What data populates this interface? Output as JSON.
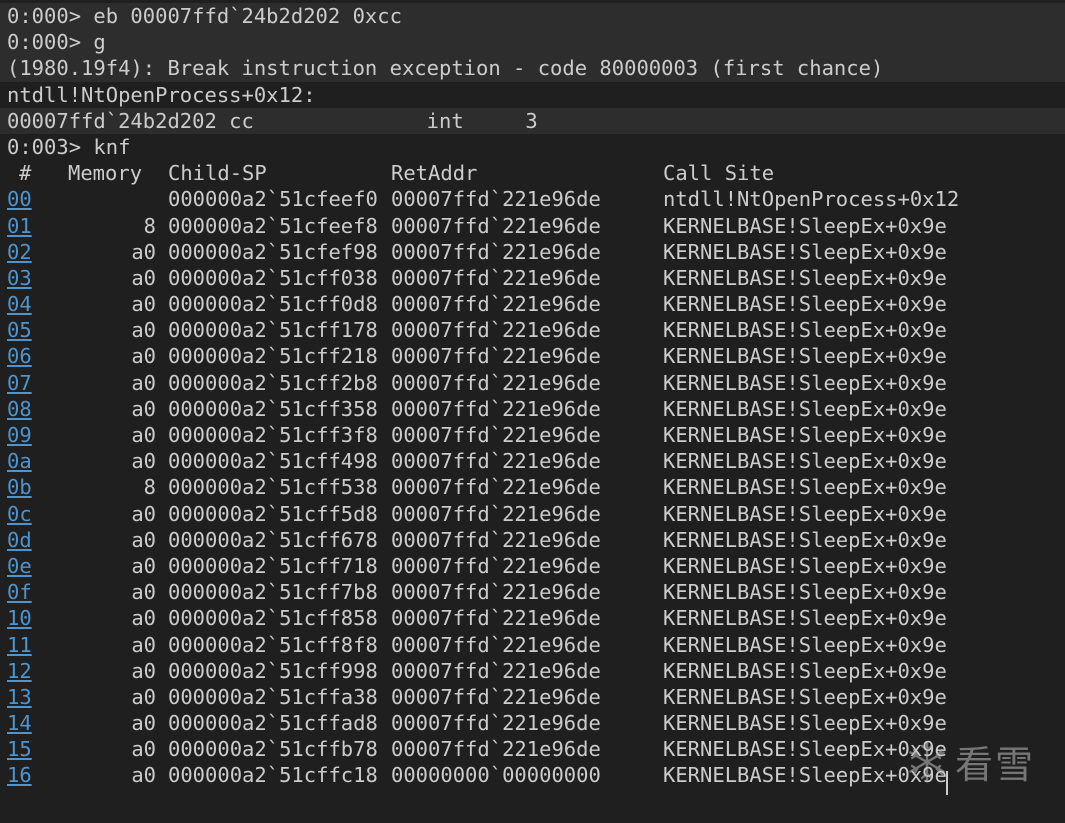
{
  "console": {
    "lines": [
      {
        "text": "0:000> eb 00007ffd`24b2d202 0xcc",
        "highlight": true
      },
      {
        "text": "0:000> g",
        "highlight": true
      },
      {
        "text": "(1980.19f4): Break instruction exception - code 80000003 (first chance)",
        "highlight": true
      },
      {
        "text": "ntdll!NtOpenProcess+0x12:",
        "highlight": false
      },
      {
        "text": "00007ffd`24b2d202 cc              int     3",
        "highlight": true
      },
      {
        "text": "0:003> knf",
        "highlight": false
      }
    ]
  },
  "stack_table": {
    "headers": {
      "num": "#",
      "memory": "Memory",
      "child_sp": "Child-SP",
      "ret_addr": "RetAddr",
      "call_site": "Call Site"
    },
    "rows": [
      {
        "num": "00",
        "memory": "",
        "child_sp": "000000a2`51cfeef0",
        "ret_addr": "00007ffd`221e96de",
        "call_site": "ntdll!NtOpenProcess+0x12"
      },
      {
        "num": "01",
        "memory": "8",
        "child_sp": "000000a2`51cfeef8",
        "ret_addr": "00007ffd`221e96de",
        "call_site": "KERNELBASE!SleepEx+0x9e"
      },
      {
        "num": "02",
        "memory": "a0",
        "child_sp": "000000a2`51cfef98",
        "ret_addr": "00007ffd`221e96de",
        "call_site": "KERNELBASE!SleepEx+0x9e"
      },
      {
        "num": "03",
        "memory": "a0",
        "child_sp": "000000a2`51cff038",
        "ret_addr": "00007ffd`221e96de",
        "call_site": "KERNELBASE!SleepEx+0x9e"
      },
      {
        "num": "04",
        "memory": "a0",
        "child_sp": "000000a2`51cff0d8",
        "ret_addr": "00007ffd`221e96de",
        "call_site": "KERNELBASE!SleepEx+0x9e"
      },
      {
        "num": "05",
        "memory": "a0",
        "child_sp": "000000a2`51cff178",
        "ret_addr": "00007ffd`221e96de",
        "call_site": "KERNELBASE!SleepEx+0x9e"
      },
      {
        "num": "06",
        "memory": "a0",
        "child_sp": "000000a2`51cff218",
        "ret_addr": "00007ffd`221e96de",
        "call_site": "KERNELBASE!SleepEx+0x9e"
      },
      {
        "num": "07",
        "memory": "a0",
        "child_sp": "000000a2`51cff2b8",
        "ret_addr": "00007ffd`221e96de",
        "call_site": "KERNELBASE!SleepEx+0x9e"
      },
      {
        "num": "08",
        "memory": "a0",
        "child_sp": "000000a2`51cff358",
        "ret_addr": "00007ffd`221e96de",
        "call_site": "KERNELBASE!SleepEx+0x9e"
      },
      {
        "num": "09",
        "memory": "a0",
        "child_sp": "000000a2`51cff3f8",
        "ret_addr": "00007ffd`221e96de",
        "call_site": "KERNELBASE!SleepEx+0x9e"
      },
      {
        "num": "0a",
        "memory": "a0",
        "child_sp": "000000a2`51cff498",
        "ret_addr": "00007ffd`221e96de",
        "call_site": "KERNELBASE!SleepEx+0x9e"
      },
      {
        "num": "0b",
        "memory": "8",
        "child_sp": "000000a2`51cff538",
        "ret_addr": "00007ffd`221e96de",
        "call_site": "KERNELBASE!SleepEx+0x9e"
      },
      {
        "num": "0c",
        "memory": "a0",
        "child_sp": "000000a2`51cff5d8",
        "ret_addr": "00007ffd`221e96de",
        "call_site": "KERNELBASE!SleepEx+0x9e"
      },
      {
        "num": "0d",
        "memory": "a0",
        "child_sp": "000000a2`51cff678",
        "ret_addr": "00007ffd`221e96de",
        "call_site": "KERNELBASE!SleepEx+0x9e"
      },
      {
        "num": "0e",
        "memory": "a0",
        "child_sp": "000000a2`51cff718",
        "ret_addr": "00007ffd`221e96de",
        "call_site": "KERNELBASE!SleepEx+0x9e"
      },
      {
        "num": "0f",
        "memory": "a0",
        "child_sp": "000000a2`51cff7b8",
        "ret_addr": "00007ffd`221e96de",
        "call_site": "KERNELBASE!SleepEx+0x9e"
      },
      {
        "num": "10",
        "memory": "a0",
        "child_sp": "000000a2`51cff858",
        "ret_addr": "00007ffd`221e96de",
        "call_site": "KERNELBASE!SleepEx+0x9e"
      },
      {
        "num": "11",
        "memory": "a0",
        "child_sp": "000000a2`51cff8f8",
        "ret_addr": "00007ffd`221e96de",
        "call_site": "KERNELBASE!SleepEx+0x9e"
      },
      {
        "num": "12",
        "memory": "a0",
        "child_sp": "000000a2`51cff998",
        "ret_addr": "00007ffd`221e96de",
        "call_site": "KERNELBASE!SleepEx+0x9e"
      },
      {
        "num": "13",
        "memory": "a0",
        "child_sp": "000000a2`51cffa38",
        "ret_addr": "00007ffd`221e96de",
        "call_site": "KERNELBASE!SleepEx+0x9e"
      },
      {
        "num": "14",
        "memory": "a0",
        "child_sp": "000000a2`51cffad8",
        "ret_addr": "00007ffd`221e96de",
        "call_site": "KERNELBASE!SleepEx+0x9e"
      },
      {
        "num": "15",
        "memory": "a0",
        "child_sp": "000000a2`51cffb78",
        "ret_addr": "00007ffd`221e96de",
        "call_site": "KERNELBASE!SleepEx+0x9e"
      },
      {
        "num": "16",
        "memory": "a0",
        "child_sp": "000000a2`51cffc18",
        "ret_addr": "00000000`00000000",
        "call_site": "KERNELBASE!SleepEx+0x9e"
      }
    ]
  },
  "watermark": {
    "text": "看雪",
    "icon": "snowflake-icon"
  },
  "colors": {
    "background": "#1f1f1f",
    "highlight_background": "#2d2d2d",
    "text": "#cccccc",
    "link": "#4e94ce"
  }
}
